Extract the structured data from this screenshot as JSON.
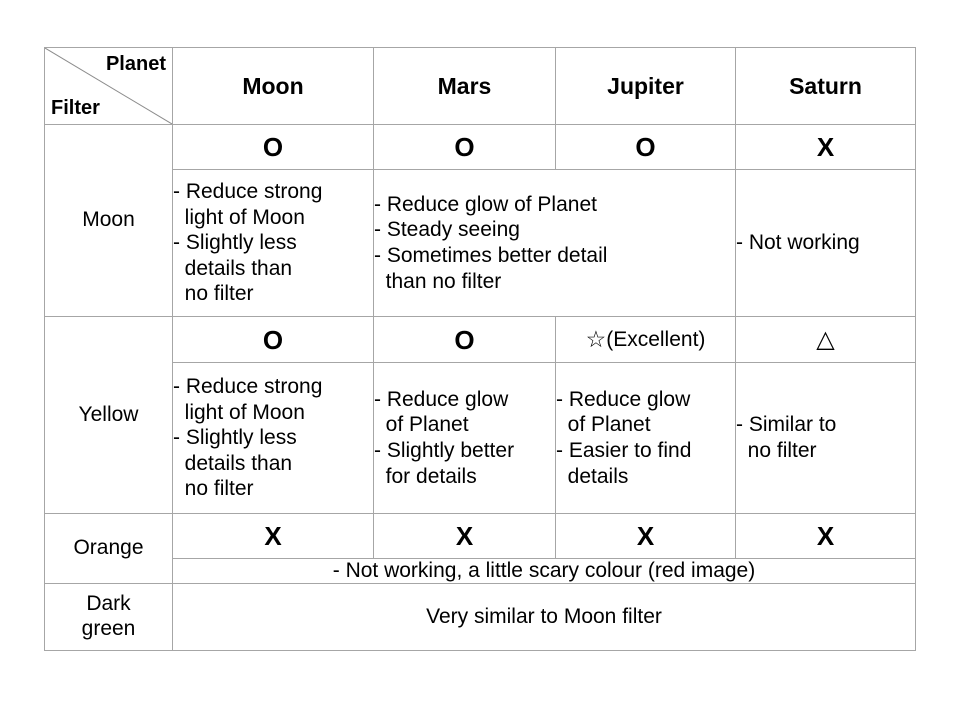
{
  "table": {
    "corner": {
      "top_right_label": "Planet",
      "bottom_left_label": "Filter",
      "diagonal": "diagonal-divider"
    },
    "header_background": "#dce3f2",
    "border_color": "#a6a6a6",
    "columns": [
      {
        "label": "Moon"
      },
      {
        "label": "Mars"
      },
      {
        "label": "Jupiter"
      },
      {
        "label": "Saturn"
      }
    ],
    "rows": [
      {
        "filter": "Moon",
        "ratings": {
          "moon": "O",
          "mars": "O",
          "jupiter": "O",
          "saturn": "X"
        },
        "notes": {
          "moon": [
            "- Reduce strong",
            "  light of Moon",
            "- Slightly less",
            "  details than",
            "  no filter"
          ],
          "mars_jupiter": [
            "- Reduce glow of Planet",
            "- Steady seeing",
            "- Sometimes better detail",
            "  than no filter"
          ],
          "saturn": [
            "- Not working"
          ]
        }
      },
      {
        "filter": "Yellow",
        "ratings": {
          "moon": "O",
          "mars": "O",
          "jupiter_symbol": "☆",
          "jupiter_text": "(Excellent)",
          "saturn": "△"
        },
        "notes": {
          "moon": [
            "- Reduce strong",
            "  light of Moon",
            "- Slightly less",
            "  details than",
            "  no filter"
          ],
          "mars": [
            "- Reduce glow",
            "  of Planet",
            "- Slightly better",
            "  for details"
          ],
          "jupiter": [
            "- Reduce glow",
            "  of Planet",
            "- Easier to find",
            "  details"
          ],
          "saturn": [
            "- Similar to",
            "  no filter"
          ]
        }
      },
      {
        "filter": "Orange",
        "ratings": {
          "moon": "X",
          "mars": "X",
          "jupiter": "X",
          "saturn": "X"
        },
        "notes": {
          "all": "- Not working, a little scary colour (red image)"
        }
      },
      {
        "filter": "Dark\ngreen",
        "filter_line1": "Dark",
        "filter_line2": "green",
        "notes": {
          "all": "Very similar to Moon filter"
        }
      }
    ]
  }
}
